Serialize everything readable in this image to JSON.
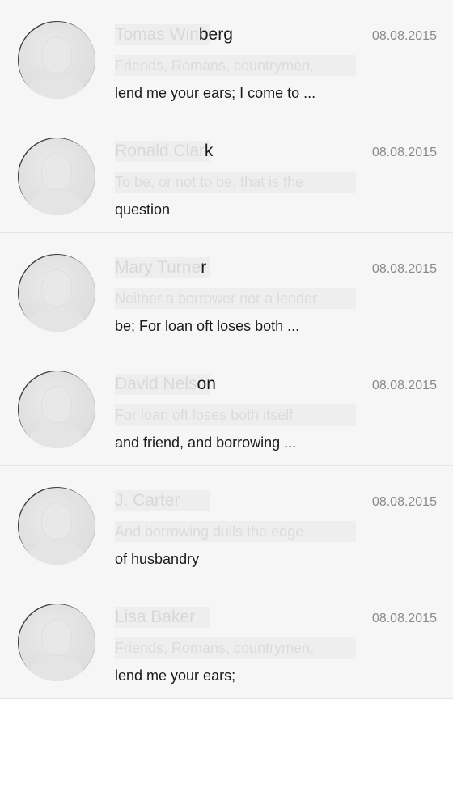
{
  "conversations": [
    {
      "name_faded": "Tomas Win",
      "name_visible": "berg",
      "date": "08.08.2015",
      "preview_line1": "Friends, Romans, countrymen,",
      "preview_line2": "lend me your ears; I come to ..."
    },
    {
      "name_faded": "Ronald Clar",
      "name_visible": "k",
      "date": "08.08.2015",
      "preview_line1": "To be, or not to be: that is the",
      "preview_line2": "question"
    },
    {
      "name_faded": "Mary Turne",
      "name_visible": "r",
      "date": "08.08.2015",
      "preview_line1": "Neither a borrower nor a lender",
      "preview_line2": "be; For loan oft loses both ..."
    },
    {
      "name_faded": "David Nels",
      "name_visible": "on",
      "date": "08.08.2015",
      "preview_line1": "For loan oft loses both itself",
      "preview_line2": "and friend, and borrowing ..."
    },
    {
      "name_faded": "J. Carter",
      "name_visible": "",
      "date": "08.08.2015",
      "preview_line1": "And borrowing dulls the edge",
      "preview_line2": "of husbandry"
    },
    {
      "name_faded": "Lisa Baker",
      "name_visible": "",
      "date": "08.08.2015",
      "preview_line1": "Friends, Romans, countrymen,",
      "preview_line2": "lend me your ears;"
    }
  ]
}
